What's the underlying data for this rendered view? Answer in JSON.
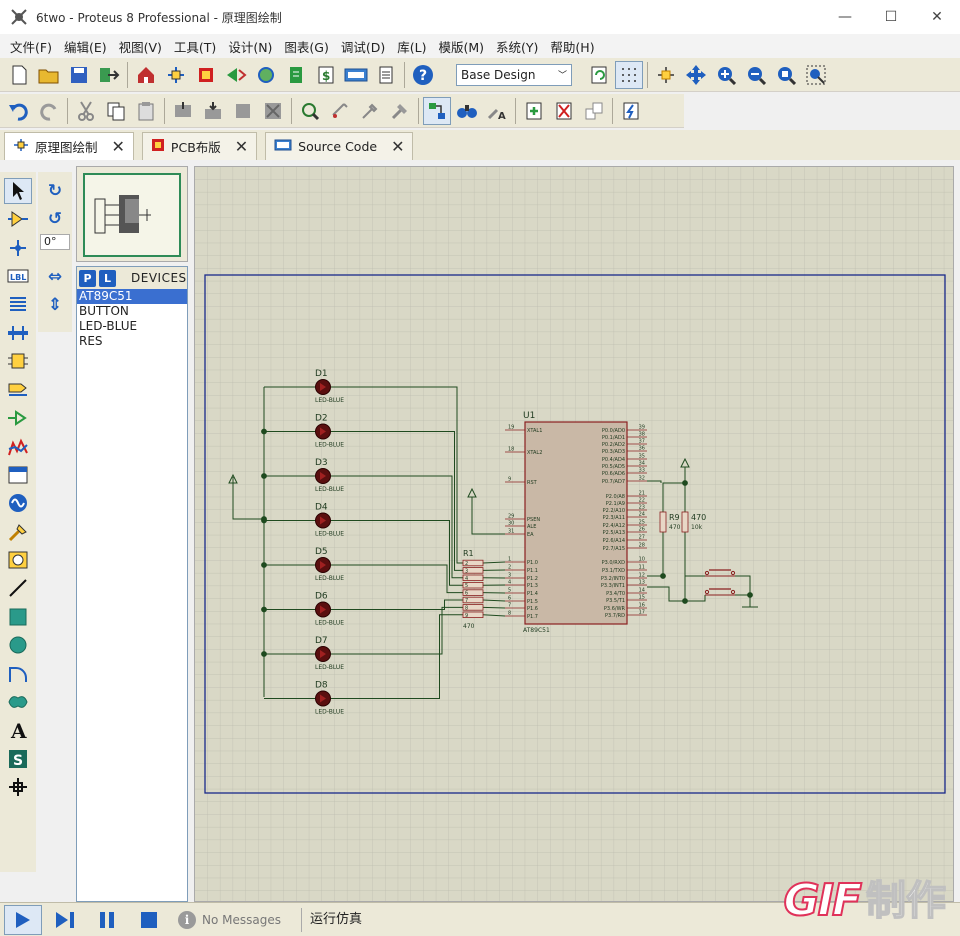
{
  "window": {
    "title": "6two - Proteus 8 Professional - 原理图绘制",
    "minimize": "—",
    "maximize": "☐",
    "close": "✕"
  },
  "menu": [
    "文件(F)",
    "编辑(E)",
    "视图(V)",
    "工具(T)",
    "设计(N)",
    "图表(G)",
    "调试(D)",
    "库(L)",
    "模版(M)",
    "系统(Y)",
    "帮助(H)"
  ],
  "toolbar": {
    "design_select": "Base Design"
  },
  "tabs": [
    {
      "label": "原理图绘制",
      "icon": "schematic-icon",
      "active": true
    },
    {
      "label": "PCB布版",
      "icon": "pcb-icon",
      "active": false
    },
    {
      "label": "Source Code",
      "icon": "source-code-icon",
      "active": false
    }
  ],
  "rotation": {
    "angle": "0°"
  },
  "devices": {
    "p": "P",
    "l": "L",
    "title": "DEVICES",
    "items": [
      "AT89C51",
      "BUTTON",
      "LED-BLUE",
      "RES"
    ],
    "selected": 0
  },
  "status": {
    "messages": "No Messages",
    "action": "运行仿真"
  },
  "watermark": {
    "logo": "GIF",
    "text": "制作"
  },
  "schematic": {
    "leds": [
      {
        "ref": "D1",
        "value": "LED-BLUE"
      },
      {
        "ref": "D2",
        "value": "LED-BLUE"
      },
      {
        "ref": "D3",
        "value": "LED-BLUE"
      },
      {
        "ref": "D4",
        "value": "LED-BLUE"
      },
      {
        "ref": "D5",
        "value": "LED-BLUE"
      },
      {
        "ref": "D6",
        "value": "LED-BLUE"
      },
      {
        "ref": "D7",
        "value": "LED-BLUE"
      },
      {
        "ref": "D8",
        "value": "LED-BLUE"
      }
    ],
    "mcu": {
      "ref": "U1",
      "part": "AT89C51",
      "left_pins": [
        {
          "num": "19",
          "name": "XTAL1"
        },
        {
          "num": "18",
          "name": "XTAL2"
        },
        {
          "num": "9",
          "name": "RST"
        },
        {
          "num": "29",
          "name": "PSEN"
        },
        {
          "num": "30",
          "name": "ALE"
        },
        {
          "num": "31",
          "name": "EA"
        },
        {
          "num": "1",
          "name": "P1.0"
        },
        {
          "num": "2",
          "name": "P1.1"
        },
        {
          "num": "3",
          "name": "P1.2"
        },
        {
          "num": "4",
          "name": "P1.3"
        },
        {
          "num": "5",
          "name": "P1.4"
        },
        {
          "num": "6",
          "name": "P1.5"
        },
        {
          "num": "7",
          "name": "P1.6"
        },
        {
          "num": "8",
          "name": "P1.7"
        }
      ],
      "right_pins": [
        {
          "num": "39",
          "name": "P0.0/AD0"
        },
        {
          "num": "38",
          "name": "P0.1/AD1"
        },
        {
          "num": "37",
          "name": "P0.2/AD2"
        },
        {
          "num": "36",
          "name": "P0.3/AD3"
        },
        {
          "num": "35",
          "name": "P0.4/AD4"
        },
        {
          "num": "34",
          "name": "P0.5/AD5"
        },
        {
          "num": "33",
          "name": "P0.6/AD6"
        },
        {
          "num": "32",
          "name": "P0.7/AD7"
        },
        {
          "num": "21",
          "name": "P2.0/A8"
        },
        {
          "num": "22",
          "name": "P2.1/A9"
        },
        {
          "num": "23",
          "name": "P2.2/A10"
        },
        {
          "num": "24",
          "name": "P2.3/A11"
        },
        {
          "num": "25",
          "name": "P2.4/A12"
        },
        {
          "num": "26",
          "name": "P2.5/A13"
        },
        {
          "num": "27",
          "name": "P2.6/A14"
        },
        {
          "num": "28",
          "name": "P2.7/A15"
        },
        {
          "num": "10",
          "name": "P3.0/RXD"
        },
        {
          "num": "11",
          "name": "P3.1/TXD"
        },
        {
          "num": "12",
          "name": "P3.2/INT0"
        },
        {
          "num": "13",
          "name": "P3.3/INT1"
        },
        {
          "num": "14",
          "name": "P3.4/T0"
        },
        {
          "num": "15",
          "name": "P3.5/T1"
        },
        {
          "num": "16",
          "name": "P3.6/WR"
        },
        {
          "num": "17",
          "name": "P3.7/RD"
        }
      ]
    },
    "resnet": {
      "ref": "R1",
      "value": "470",
      "pins": [
        "2",
        "3",
        "4",
        "5",
        "6",
        "7",
        "8",
        "9"
      ]
    },
    "resistors": [
      {
        "ref": "R9",
        "value": "470"
      },
      {
        "ref": "470",
        "value": "10k"
      }
    ]
  }
}
